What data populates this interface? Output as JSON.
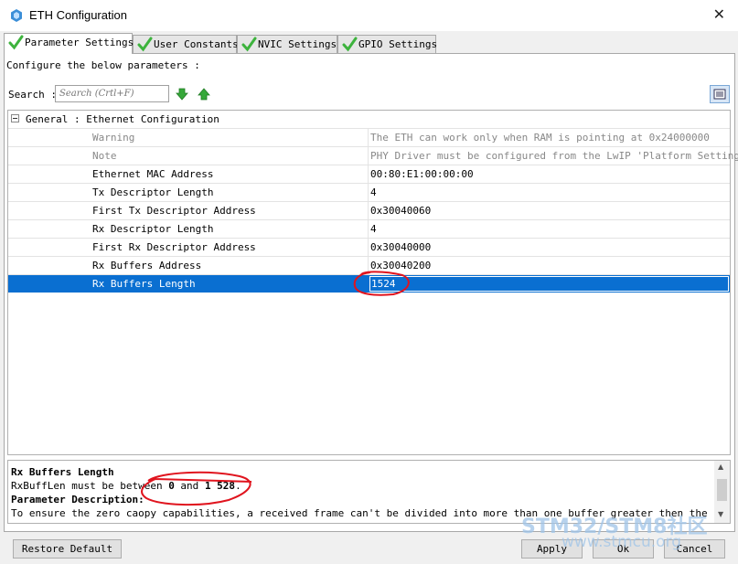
{
  "window": {
    "title": "ETH Configuration",
    "close_glyph": "✕",
    "app_icon": "cube-icon"
  },
  "tabs": [
    {
      "label": "Parameter Settings",
      "active": true
    },
    {
      "label": "User Constants",
      "active": false
    },
    {
      "label": "NVIC Settings",
      "active": false
    },
    {
      "label": "GPIO Settings",
      "active": false
    }
  ],
  "toolbar": {
    "configure_label": "Configure the below parameters :",
    "search_label": "Search :",
    "search_placeholder": "Search (Crtl+F)"
  },
  "grid": {
    "group_label": "General : Ethernet Configuration",
    "rows": [
      {
        "name": "Warning",
        "value": "The ETH can work only when RAM is pointing at 0x24000000",
        "readonly": true
      },
      {
        "name": "Note",
        "value": "PHY Driver must be configured from the LwIP 'Platform Settings...",
        "readonly": true
      },
      {
        "name": "Ethernet MAC Address",
        "value": "00:80:E1:00:00:00",
        "readonly": false
      },
      {
        "name": "Tx Descriptor Length",
        "value": "4",
        "readonly": false
      },
      {
        "name": "First Tx Descriptor Address",
        "value": "0x30040060",
        "readonly": false
      },
      {
        "name": "Rx Descriptor Length",
        "value": "4",
        "readonly": false
      },
      {
        "name": "First Rx Descriptor Address",
        "value": "0x30040000",
        "readonly": false
      },
      {
        "name": "Rx Buffers Address",
        "value": "0x30040200",
        "readonly": false
      },
      {
        "name": "Rx Buffers Length",
        "value": "1524",
        "readonly": false,
        "selected": true
      }
    ]
  },
  "description": {
    "title": "Rx Buffers Length",
    "constraint_prefix": "RxBuffLen must be between ",
    "min": "0",
    "and": " and ",
    "max": "1 528",
    "suffix": ".",
    "param_heading": "Parameter Description:",
    "param_text": "To ensure the zero caopy capabilities, a received frame can't be divided into more than one buffer greater then the Rx Buffers"
  },
  "buttons": {
    "restore_default": "Restore Default",
    "apply": "Apply",
    "ok": "Ok",
    "cancel": "Cancel"
  },
  "watermark": {
    "line1": "STM32/STM8社区",
    "line2": "www.stmcu.org"
  },
  "colors": {
    "selection": "#0a6fd1",
    "check": "#3db33d",
    "annotation": "#e0141e"
  }
}
